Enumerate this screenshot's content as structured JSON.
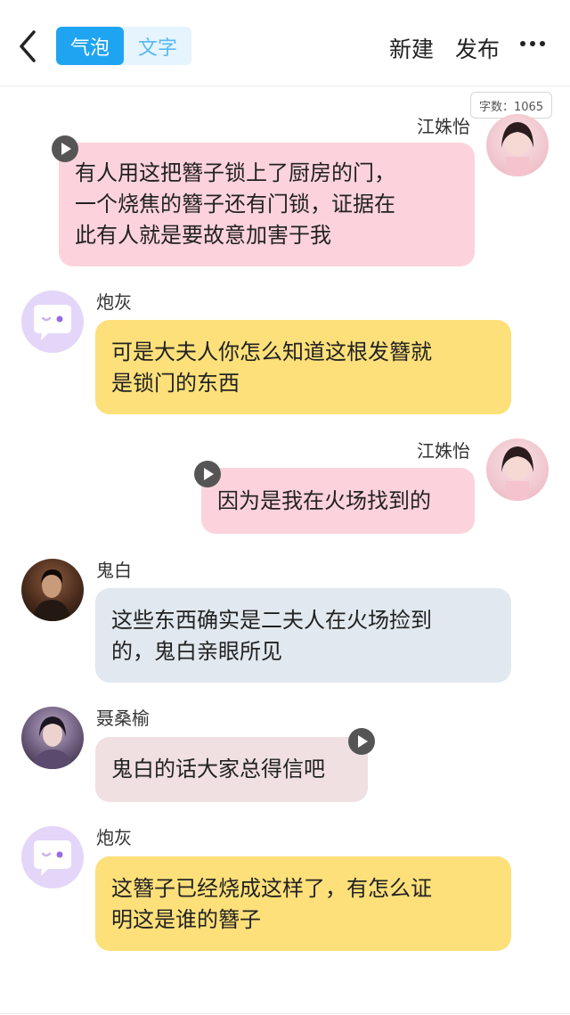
{
  "header": {
    "tabs": [
      "气泡",
      "文字"
    ],
    "new_label": "新建",
    "publish_label": "发布"
  },
  "word_count": "字数：1065",
  "messages": [
    {
      "sender": "江姝怡",
      "lines": [
        "有人用这把簪子锁上了厨房的门，",
        "一个烧焦的簪子还有门锁，证据在",
        "此有人就是要故意加害于我"
      ]
    },
    {
      "sender": "炮灰",
      "lines": [
        "可是大夫人你怎么知道这根发簪就",
        "是锁门的东西"
      ]
    },
    {
      "sender": "江姝怡",
      "lines": [
        "因为是我在火场找到的"
      ]
    },
    {
      "sender": "鬼白",
      "lines": [
        "这些东西确实是二夫人在火场捡到",
        "的，鬼白亲眼所见"
      ]
    },
    {
      "sender": "聂桑榆",
      "lines": [
        "鬼白的话大家总得信吧"
      ]
    },
    {
      "sender": "炮灰",
      "lines": [
        "这簪子已经烧成这样了，有怎么证",
        "明这是谁的簪子"
      ]
    }
  ],
  "colors": {
    "accent": "#1fa4f2",
    "bubble_pink": "#fcd3dc",
    "bubble_yellow": "#fde07a",
    "bubble_gray": "#e2e8ef",
    "bubble_rose": "#f0e0e2"
  },
  "icons": [
    "back-arrow-icon",
    "more-dots-icon",
    "play-icon",
    "chat-bubble-icon"
  ]
}
